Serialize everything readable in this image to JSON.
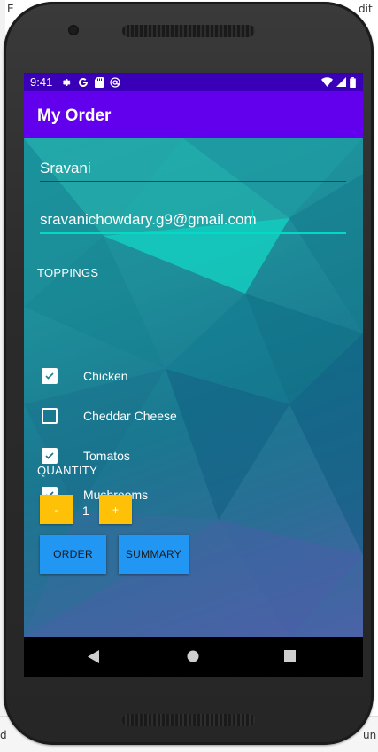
{
  "status_bar": {
    "time": "9:41",
    "left_icons": [
      "gear-icon",
      "google-icon",
      "sd-card-icon",
      "at-sign-icon"
    ],
    "right_icons": [
      "wifi-icon",
      "signal-icon",
      "battery-icon"
    ]
  },
  "app_bar": {
    "title": "My Order"
  },
  "form": {
    "name_value": "Sravani",
    "email_value": "sravanichowdary.g9@gmail.com"
  },
  "toppings": {
    "header": "TOPPINGS",
    "items": [
      {
        "label": "Chicken",
        "checked": true
      },
      {
        "label": "Cheddar Cheese",
        "checked": false
      },
      {
        "label": "Tomatos",
        "checked": true
      },
      {
        "label": "Mushrooms",
        "checked": true
      }
    ]
  },
  "quantity": {
    "header": "QUANTITY",
    "decrement_label": "-",
    "value": "1",
    "increment_label": "+"
  },
  "actions": {
    "order_label": "ORDER",
    "summary_label": "SUMMARY"
  },
  "colors": {
    "status_bar": "#3a00b8",
    "app_bar": "#6200ee",
    "accent": "#03dac5",
    "quantity_button": "#ffc107",
    "action_button": "#2196f3"
  },
  "nav_bar": {
    "icons": [
      "back-icon",
      "home-icon",
      "recents-icon"
    ]
  },
  "ide_fragments": {
    "top_left": "E",
    "top_right": "dit",
    "bottom_left": "d",
    "bottom_right": "un"
  }
}
